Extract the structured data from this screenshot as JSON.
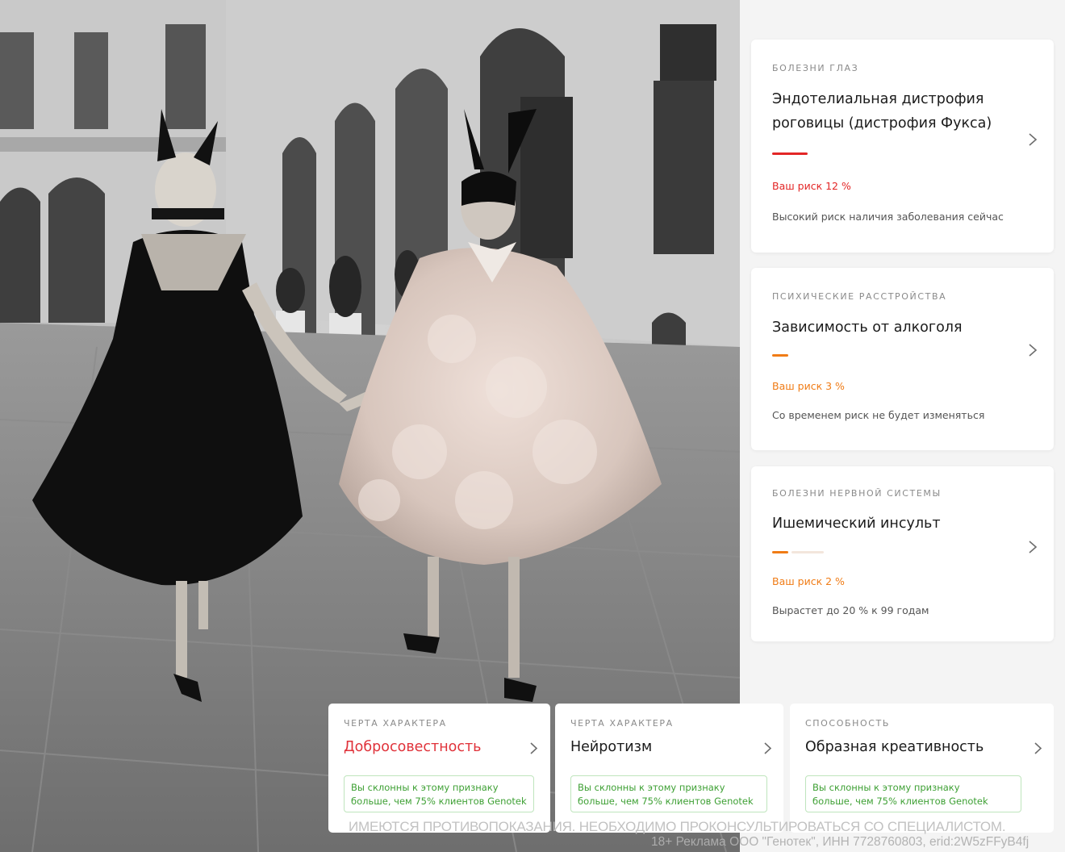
{
  "colors": {
    "high_risk": "#e32626",
    "medium_risk": "#f07c16",
    "positive": "#3ea034",
    "positive_border": "#bfe5bd",
    "highlight_title": "#e0323a"
  },
  "disease_cards": [
    {
      "category": "БОЛЕЗНИ ГЛАЗ",
      "title_line1": "Эндотелиальная дистрофия",
      "title_line2": "роговицы (дистрофия Фукса)",
      "risk": "Ваш риск 12 %",
      "note": "Высокий риск наличия заболевания сейчас",
      "risk_level": "high",
      "icon": "chevron-right-icon"
    },
    {
      "category": "ПСИХИЧЕСКИЕ РАССТРОЙСТВА",
      "title_line1": "Зависимость от алкоголя",
      "risk": "Ваш риск 3 %",
      "note": "Со временем риск не будет изменяться",
      "risk_level": "medium",
      "icon": "chevron-right-icon"
    },
    {
      "category": "БОЛЕЗНИ НЕРВНОЙ СИСТЕМЫ",
      "title_line1": "Ишемический инсульт",
      "risk": "Ваш риск 2 %",
      "note": "Вырастет до 20 % к 99 годам",
      "risk_level": "medium",
      "icon": "chevron-right-icon"
    }
  ],
  "trait_cards": [
    {
      "category": "ЧЕРТА ХАРАКТЕРА",
      "title": "Добросовестность",
      "badge_line1": "Вы склонны к этому признаку",
      "badge_line2": "больше, чем 75% клиентов Genotek",
      "icon": "chevron-right-icon"
    },
    {
      "category": "ЧЕРТА ХАРАКТЕРА",
      "title": "Нейротизм",
      "badge_line1": "Вы склонны к этому признаку",
      "badge_line2": "больше, чем 75% клиентов Genotek",
      "icon": "chevron-right-icon"
    },
    {
      "category": "СПОСОБНОСТЬ",
      "title": "Образная креативность",
      "badge_line1": "Вы склонны к этому признаку",
      "badge_line2": "больше, чем 75% клиентов Genotek",
      "icon": "chevron-right-icon"
    }
  ],
  "disclaimer": {
    "line1": "ИМЕЮТСЯ ПРОТИВОПОКАЗАНИЯ. НЕОБХОДИМО ПРОКОНСУЛЬТИРОВАТЬСЯ СО СПЕЦИАЛИСТОМ.",
    "line2": "18+ Реклама ООО \"Генотек\", ИНН 7728760803, erid:2W5zFFyB4fj"
  }
}
